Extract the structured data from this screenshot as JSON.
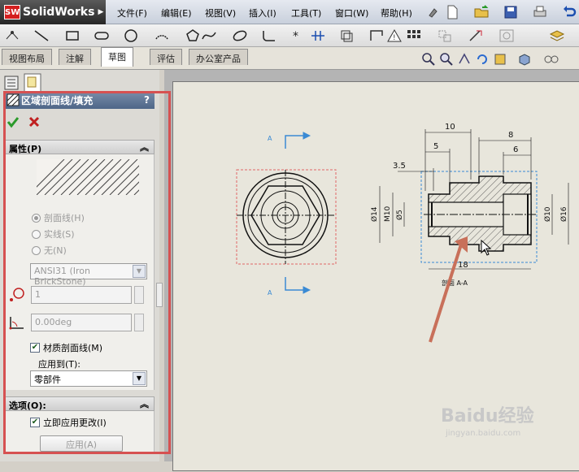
{
  "app": {
    "logo_mark": "SW",
    "logo_text": "SolidWorks"
  },
  "menu": {
    "items": [
      "文件(F)",
      "编辑(E)",
      "视图(V)",
      "插入(I)",
      "工具(T)",
      "窗口(W)",
      "帮助(H)"
    ]
  },
  "tabs": [
    "视图布局",
    "注解",
    "草图",
    "评估",
    "办公室产品"
  ],
  "active_tab": "草图",
  "property_manager": {
    "title": "区域剖面线/填充",
    "help": "?",
    "properties_group": {
      "title": "属性(P)",
      "radio_hatch": "剖面线(H)",
      "radio_solid": "实线(S)",
      "radio_none": "无(N)",
      "pattern": "ANSI31 (Iron BrickStone)",
      "scale": "1",
      "angle": "0.00deg",
      "material_hatch": "材质剖面线(M)",
      "apply_to_label": "应用到(T):",
      "apply_to_value": "零部件"
    },
    "options_group": {
      "title": "选项(O):",
      "apply_immediately": "立即应用更改(I)",
      "apply_button": "应用(A)"
    }
  },
  "drawing": {
    "dim_10": "10",
    "dim_5": "5",
    "dim_3_5": "3.5",
    "dim_8": "8",
    "dim_6": "6",
    "dim_phi14": "Ø14",
    "dim_m10": "M10",
    "dim_phi5": "Ø5",
    "dim_phi10": "Ø10",
    "dim_phi16": "Ø16",
    "dim_18": "18",
    "section_label": "剖面 A-A",
    "section_mark_top": "A",
    "section_mark_bottom": "A"
  },
  "watermark": {
    "main": "Baidu经验",
    "sub": "jingyan.baidu.com"
  },
  "colors": {
    "highlight": "#d65151",
    "arrow": "#c8705a",
    "section_line": "#3a8ad4",
    "selection": "#e06666"
  }
}
